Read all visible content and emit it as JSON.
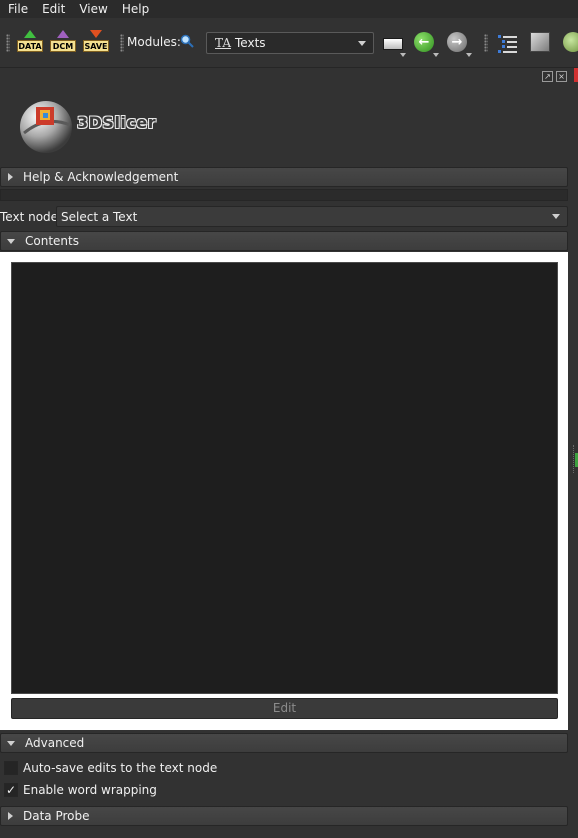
{
  "menu": {
    "file": "File",
    "edit": "Edit",
    "view": "View",
    "help": "Help"
  },
  "toolbar": {
    "data_label": "DATA",
    "dcm_label": "DCM",
    "save_label": "SAVE",
    "modules_label": "Modules:",
    "module_icon_text": "TA",
    "module_selected": "Texts"
  },
  "logo": {
    "text": "3DSlicer"
  },
  "sections": {
    "help": "Help & Acknowledgement",
    "contents": "Contents",
    "advanced": "Advanced",
    "data_probe": "Data Probe"
  },
  "text_node": {
    "label": "Text node:",
    "value": "Select a Text"
  },
  "contents": {
    "edit_button": "Edit"
  },
  "advanced": {
    "auto_save_label": "Auto-save edits to the text node",
    "auto_save_checked": false,
    "word_wrap_label": "Enable word wrapping",
    "word_wrap_checked": true,
    "check_glyph": "✓"
  },
  "icons": {
    "search": "search-icon",
    "back": "back-arrow-icon",
    "forward": "forward-arrow-icon",
    "layout": "layout-icon",
    "tree": "data-tree-icon",
    "cube": "cube-icon",
    "extension": "extension-icon"
  }
}
